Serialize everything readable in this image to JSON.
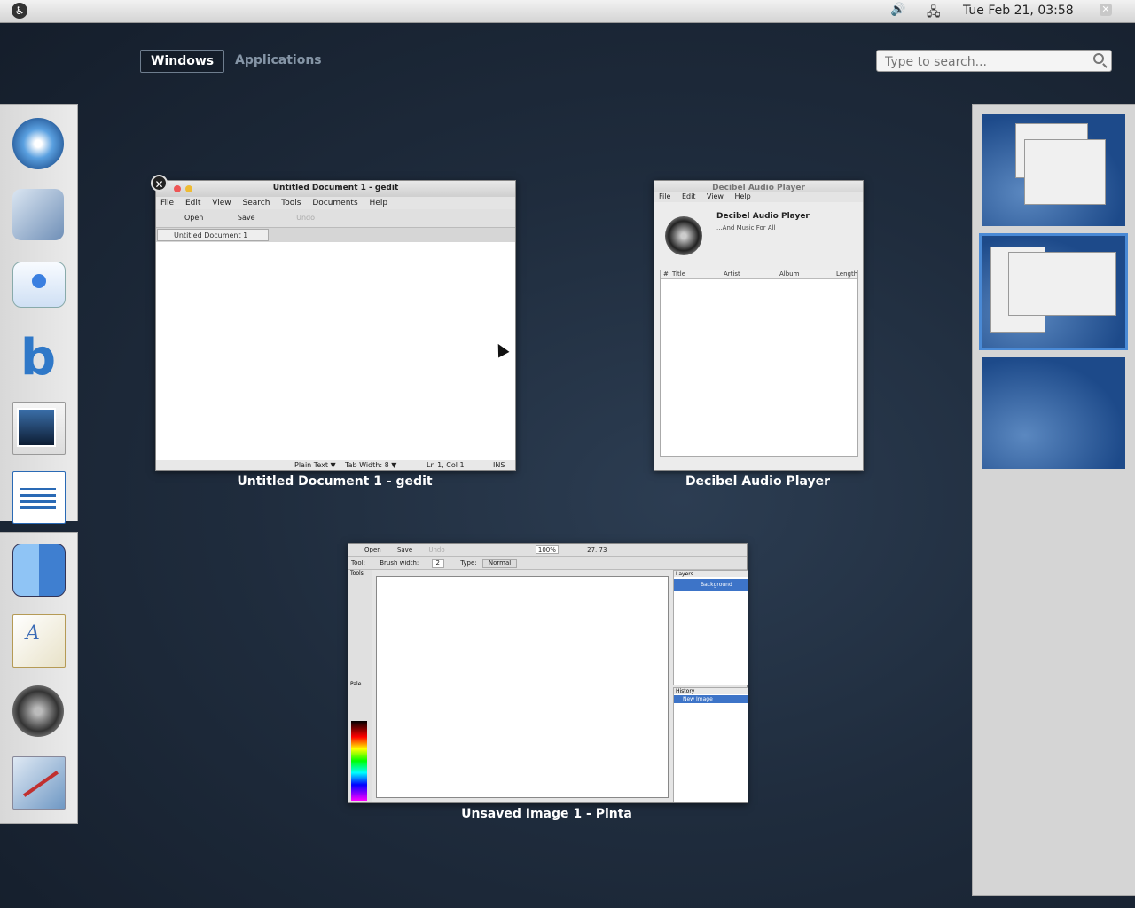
{
  "topbar": {
    "clock": "Tue Feb 21, 03:58",
    "a11y_glyph": "♿",
    "volume_glyph": "🔊",
    "network_glyph": "🖧",
    "close_glyph": "✕"
  },
  "overview": {
    "tabs": [
      {
        "label": "Windows",
        "active": true
      },
      {
        "label": "Applications",
        "active": false
      }
    ],
    "search": {
      "placeholder": "Type to search..."
    }
  },
  "dash": {
    "apps": [
      {
        "icon": "safari-compass-icon",
        "color": "#3a78c2"
      },
      {
        "icon": "mail-eagle-icon",
        "color": "#6f8fb7"
      },
      {
        "icon": "chat-bubble-icon",
        "color": "#4a8fe0"
      },
      {
        "icon": "beatbox-music-icon",
        "color": "#3b75b8"
      },
      {
        "icon": "photos-icon",
        "color": "#2b4a6a"
      },
      {
        "icon": "writer-document-icon",
        "color": "#2a6ab5"
      },
      {
        "icon": "finder-face-icon",
        "color": "#3f8ae0"
      },
      {
        "icon": "textedit-icon",
        "color": "#c9a04c"
      },
      {
        "icon": "speaker-icon",
        "color": "#555555"
      },
      {
        "icon": "paint-icon",
        "color": "#6f98c4"
      }
    ]
  },
  "windows": {
    "gedit": {
      "title": "Untitled Document 1 - gedit",
      "menu": [
        "File",
        "Edit",
        "View",
        "Search",
        "Tools",
        "Documents",
        "Help"
      ],
      "toolbar": {
        "open": "Open",
        "save": "Save",
        "undo": "Undo"
      },
      "tab_label": "Untitled Document 1",
      "status": {
        "lang": "Plain Text ▼",
        "tabwidth": "Tab Width: 8 ▼",
        "pos": "Ln 1, Col 1",
        "ins": "INS"
      },
      "caption": "Untitled Document 1 - gedit"
    },
    "decibel": {
      "title": "Decibel Audio Player",
      "menu": [
        "File",
        "Edit",
        "View",
        "Help"
      ],
      "heading": "Decibel Audio Player",
      "subheading": "...And Music For All",
      "columns": [
        "#",
        "Title",
        "Artist",
        "Album",
        "Length"
      ],
      "caption": "Decibel Audio Player"
    },
    "pinta": {
      "toolbar": {
        "open": "Open",
        "save": "Save",
        "undo": "Undo",
        "zoom": "100%",
        "coords": "27, 73"
      },
      "options": {
        "tool": "Tool:",
        "brush": "Brush width:",
        "brush_val": "2",
        "type": "Type:",
        "type_val": "Normal"
      },
      "panels": {
        "tools": "Tools",
        "palette": "Pale...",
        "layers": "Layers",
        "background": "Background",
        "history": "History",
        "history_item": "New Image"
      },
      "caption": "Unsaved Image 1 - Pinta"
    }
  }
}
